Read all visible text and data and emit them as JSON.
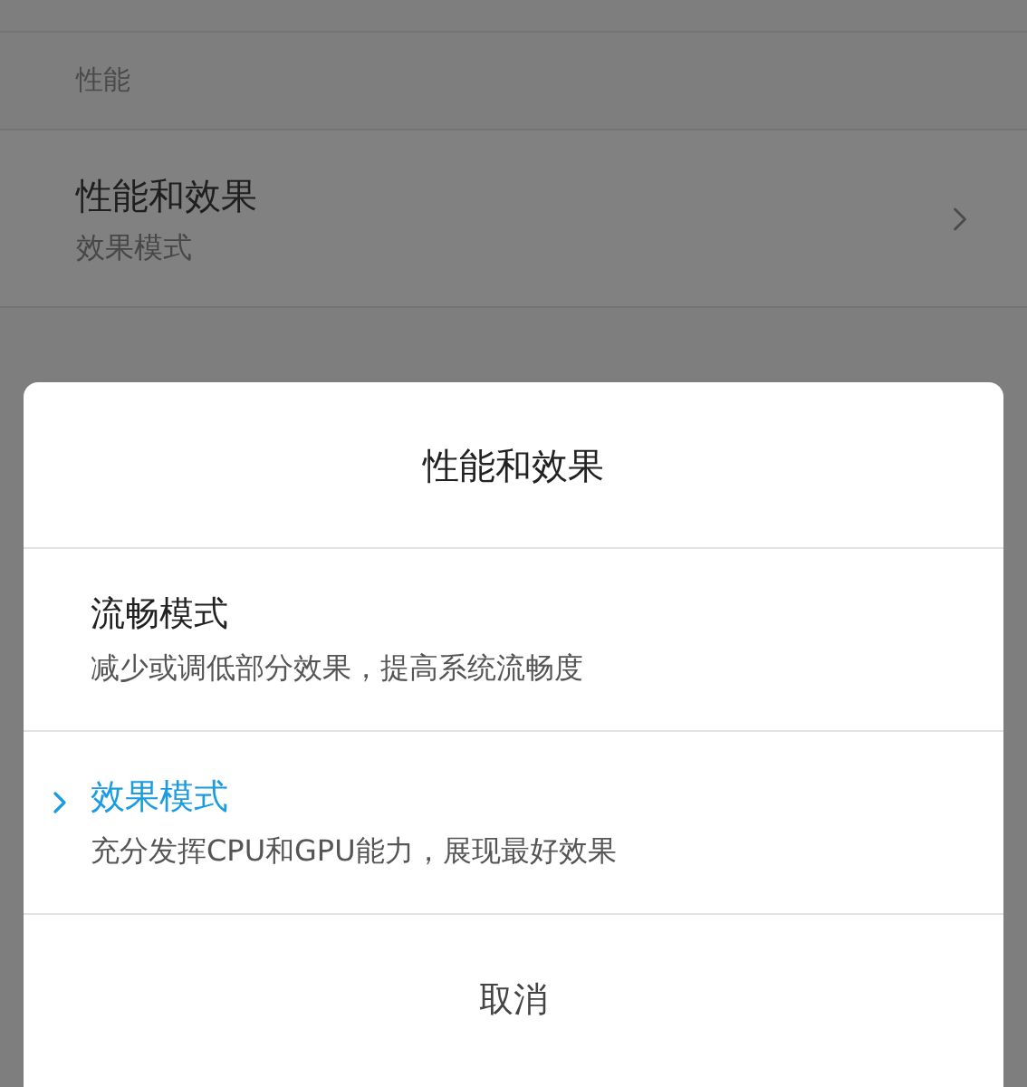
{
  "settings": {
    "section_header": "性能",
    "item": {
      "title": "性能和效果",
      "value": "效果模式"
    }
  },
  "dialog": {
    "title": "性能和效果",
    "options": [
      {
        "title": "流畅模式",
        "description": "减少或调低部分效果，提高系统流畅度",
        "selected": false
      },
      {
        "title": "效果模式",
        "description": "充分发挥CPU和GPU能力，展现最好效果",
        "selected": true
      }
    ],
    "cancel": "取消"
  }
}
